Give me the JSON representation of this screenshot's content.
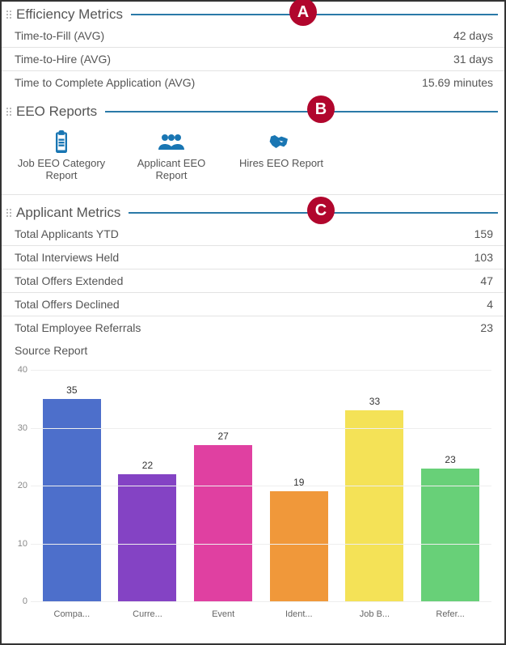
{
  "badges": {
    "a": "A",
    "b": "B",
    "c": "C"
  },
  "efficiency": {
    "title": "Efficiency Metrics",
    "rows": [
      {
        "label": "Time-to-Fill (AVG)",
        "value": "42 days"
      },
      {
        "label": "Time-to-Hire (AVG)",
        "value": "31 days"
      },
      {
        "label": "Time to Complete Application (AVG)",
        "value": "15.69 minutes"
      }
    ]
  },
  "eeo": {
    "title": "EEO Reports",
    "reports": [
      {
        "label": "Job EEO Category Report",
        "icon": "clipboard"
      },
      {
        "label": "Applicant EEO Report",
        "icon": "people"
      },
      {
        "label": "Hires EEO Report",
        "icon": "handshake"
      }
    ]
  },
  "applicant": {
    "title": "Applicant Metrics",
    "rows": [
      {
        "label": "Total Applicants YTD",
        "value": "159"
      },
      {
        "label": "Total Interviews Held",
        "value": "103"
      },
      {
        "label": "Total Offers Extended",
        "value": "47"
      },
      {
        "label": "Total Offers Declined",
        "value": "4"
      },
      {
        "label": "Total Employee Referrals",
        "value": "23"
      }
    ],
    "source_report_label": "Source Report"
  },
  "chart_data": {
    "type": "bar",
    "title": "Source Report",
    "xlabel": "",
    "ylabel": "",
    "ylim": [
      0,
      40
    ],
    "yticks": [
      0,
      10,
      20,
      30,
      40
    ],
    "categories": [
      "Compa...",
      "Curre...",
      "Event",
      "Ident...",
      "Job B...",
      "Refer..."
    ],
    "values": [
      35,
      22,
      27,
      19,
      33,
      23
    ],
    "colors": [
      "#4d6fcb",
      "#8443c4",
      "#e040a1",
      "#f0983a",
      "#f4e257",
      "#68d078"
    ]
  }
}
